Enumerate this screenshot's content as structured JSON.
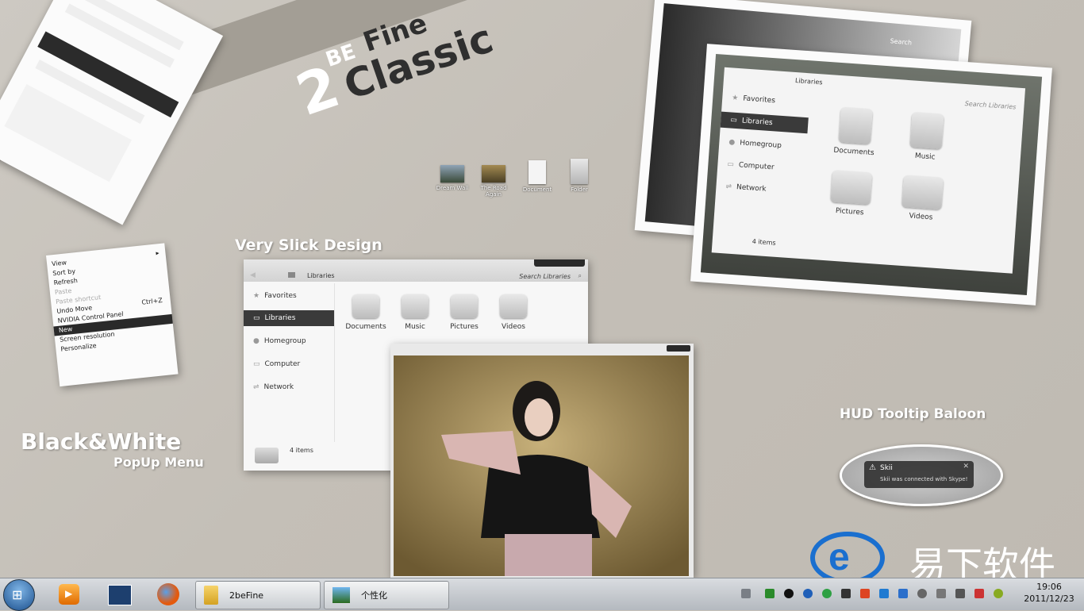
{
  "title": {
    "prefix": "2",
    "small": "BE",
    "line1": "Fine",
    "line2": "Classic"
  },
  "headings": {
    "slick": "Very Slick Design",
    "bw_big": "Black&White",
    "bw_small": "PopUp Menu",
    "hud": "HUD Tooltip Baloon"
  },
  "desktop_icons": [
    {
      "label": "Dream Wall"
    },
    {
      "label": "The Road Again"
    },
    {
      "label": "Document"
    },
    {
      "label": "Folder"
    }
  ],
  "explorer_main": {
    "breadcrumb": "Libraries",
    "search_placeholder": "Search Libraries",
    "sidebar": [
      "Favorites",
      "Libraries",
      "Homegroup",
      "Computer",
      "Network"
    ],
    "tiles": [
      "Documents",
      "Music",
      "Pictures",
      "Videos"
    ],
    "status": "4 items"
  },
  "explorer_right": {
    "breadcrumb": "Libraries",
    "search_placeholder": "Search Libraries",
    "sidebar": [
      "Favorites",
      "Libraries",
      "Homegroup",
      "Computer",
      "Network"
    ],
    "tiles": [
      "Documents",
      "Music",
      "Pictures",
      "Videos"
    ],
    "status": "4 items",
    "back_search": "Search"
  },
  "context_menu": {
    "items": [
      {
        "label": "View",
        "arrow": "▸"
      },
      {
        "label": "Sort by",
        "arrow": ""
      },
      {
        "label": "Refresh",
        "arrow": ""
      },
      {
        "label": "Paste",
        "arrow": ""
      },
      {
        "label": "Paste shortcut",
        "arrow": ""
      },
      {
        "label": "Undo Move",
        "shortcut": "Ctrl+Z"
      },
      {
        "label": "NVIDIA Control Panel",
        "arrow": ""
      },
      {
        "label": "New",
        "arrow": ""
      },
      {
        "label": "Screen resolution",
        "arrow": ""
      },
      {
        "label": "Personalize",
        "arrow": ""
      }
    ]
  },
  "balloon": {
    "title": "Skii",
    "message": "Skii was connected with Skype!"
  },
  "watermark": {
    "text": "易下软件"
  },
  "taskbar": {
    "buttons": [
      {
        "label": "2beFine"
      },
      {
        "label": "个性化"
      }
    ],
    "clock_time": "19:06",
    "clock_date": "2011/12/23"
  },
  "colors": {
    "accent": "#2f2f2f",
    "band": "#a39e95",
    "watermark_blue": "#1a6fcf"
  }
}
